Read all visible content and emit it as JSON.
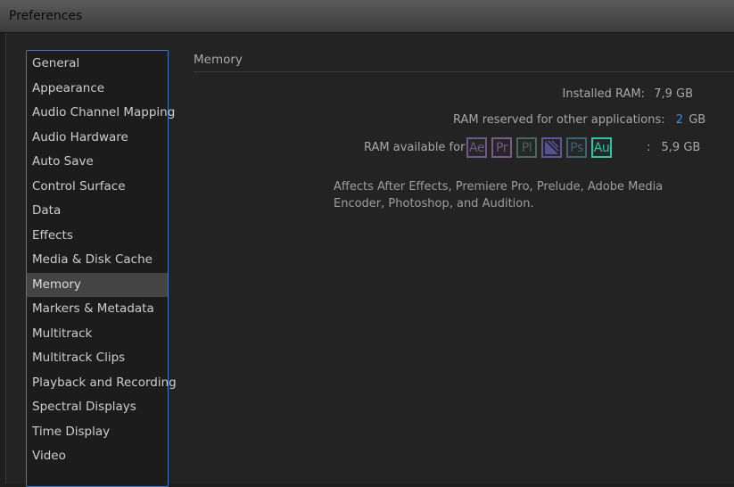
{
  "window": {
    "title": "Preferences"
  },
  "sidebar": {
    "items": [
      {
        "label": "General"
      },
      {
        "label": "Appearance"
      },
      {
        "label": "Audio Channel Mapping"
      },
      {
        "label": "Audio Hardware"
      },
      {
        "label": "Auto Save"
      },
      {
        "label": "Control Surface"
      },
      {
        "label": "Data"
      },
      {
        "label": "Effects"
      },
      {
        "label": "Media & Disk Cache"
      },
      {
        "label": "Memory",
        "selected": true
      },
      {
        "label": "Markers & Metadata"
      },
      {
        "label": "Multitrack"
      },
      {
        "label": "Multitrack Clips"
      },
      {
        "label": "Playback and Recording"
      },
      {
        "label": "Spectral Displays"
      },
      {
        "label": "Time Display"
      },
      {
        "label": "Video"
      }
    ]
  },
  "memory": {
    "section_title": "Memory",
    "installed_label": "Installed RAM:",
    "installed_value": "7,9 GB",
    "reserved_label": "RAM reserved for other applications:",
    "reserved_value": "2",
    "reserved_unit": "GB",
    "available_label": "RAM available for",
    "available_sep": ":",
    "available_value": "5,9 GB",
    "apps": [
      {
        "label": "Ae",
        "name": "after-effects-icon",
        "color": "#6b5a8a"
      },
      {
        "label": "Pr",
        "name": "premiere-pro-icon",
        "color": "#7a5a88"
      },
      {
        "label": "Pl",
        "name": "prelude-icon",
        "color": "#47675f"
      },
      {
        "label": "",
        "name": "media-encoder-icon",
        "color": "#5d55a0"
      },
      {
        "label": "Ps",
        "name": "photoshop-icon",
        "color": "#3f6274"
      },
      {
        "label": "Au",
        "name": "audition-icon",
        "color": "#28c7a5"
      }
    ],
    "description": "Affects After Effects, Premiere Pro, Prelude, Adobe Media Encoder, Photoshop, and Audition."
  }
}
